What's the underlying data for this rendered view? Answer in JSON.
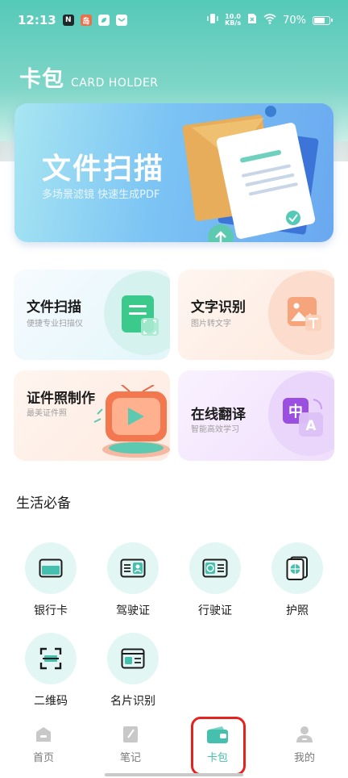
{
  "status_bar": {
    "time": "12:13",
    "app_badges": [
      "N",
      "岛",
      "",
      ""
    ],
    "net_speed_value": "10.0",
    "net_speed_unit": "KB/s",
    "battery": "70%"
  },
  "header": {
    "title": "卡包",
    "subtitle": "CARD HOLDER"
  },
  "banner": {
    "title": "文件扫描",
    "subtitle": "多场景滤镜  快速生成PDF"
  },
  "cards": [
    {
      "title": "文件扫描",
      "subtitle": "便捷专业扫描仪"
    },
    {
      "title": "文字识别",
      "subtitle": "图片转文字"
    },
    {
      "title": "证件照制作",
      "subtitle": "最美证件照"
    },
    {
      "title": "在线翻译",
      "subtitle": "智能高效学习"
    }
  ],
  "section": {
    "title": "生活必备"
  },
  "tools": [
    {
      "label": "银行卡",
      "icon": "bank-card-icon"
    },
    {
      "label": "驾驶证",
      "icon": "driver-license-icon"
    },
    {
      "label": "行驶证",
      "icon": "vehicle-license-icon"
    },
    {
      "label": "护照",
      "icon": "passport-icon"
    },
    {
      "label": "二维码",
      "icon": "qr-code-icon"
    },
    {
      "label": "名片识别",
      "icon": "business-card-icon"
    }
  ],
  "bottom_nav": [
    {
      "label": "首页",
      "icon": "home-icon"
    },
    {
      "label": "笔记",
      "icon": "notes-icon"
    },
    {
      "label": "卡包",
      "icon": "wallet-icon",
      "active": true
    },
    {
      "label": "我的",
      "icon": "profile-icon"
    }
  ],
  "colors": {
    "accent": "#45c0ae",
    "header_top": "#55c9b8",
    "highlight": "#e4231f"
  }
}
